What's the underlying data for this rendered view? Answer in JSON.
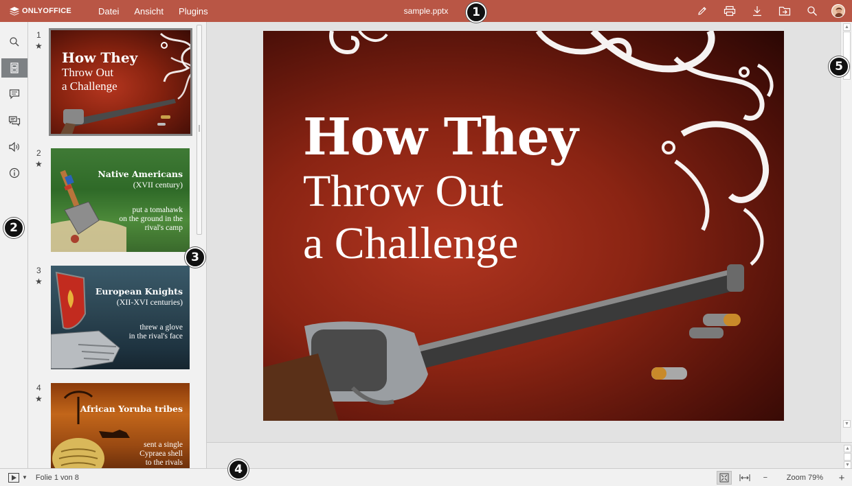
{
  "app": {
    "logo_text": "ONLYOFFICE",
    "document_title": "sample.pptx",
    "menu": [
      "Datei",
      "Ansicht",
      "Plugins"
    ],
    "header_icons": [
      "edit-icon",
      "print-icon",
      "download-icon",
      "open-folder-icon",
      "search-icon",
      "user-avatar"
    ]
  },
  "leftbar": {
    "items": [
      {
        "name": "search-icon",
        "active": false
      },
      {
        "name": "slides-thumbnails-icon",
        "active": true
      },
      {
        "name": "comments-icon",
        "active": false
      },
      {
        "name": "chat-icon",
        "active": false
      },
      {
        "name": "speaker-icon",
        "active": false
      },
      {
        "name": "info-icon",
        "active": false
      }
    ]
  },
  "thumbnails": [
    {
      "number": "1",
      "title": "How They",
      "subtitle": "Throw Out\na Challenge",
      "text": ""
    },
    {
      "number": "2",
      "title": "Native Americans",
      "subtitle": "(XVII century)",
      "text": "put a tomahawk\non the ground in the\nrival's camp"
    },
    {
      "number": "3",
      "title": "European Knights",
      "subtitle": "(XII-XVI centuries)",
      "text": "threw a glove\nin the rival's face"
    },
    {
      "number": "4",
      "title": "African Yoruba tribes",
      "subtitle": "",
      "text": "sent a single\nCypraea shell\nto the rivals"
    }
  ],
  "slide": {
    "title_line1": "How They",
    "title_line2": "Throw Out\na Challenge"
  },
  "statusbar": {
    "slide_info": "Folie 1 von 8",
    "zoom_label": "Zoom 79%",
    "zoom_minus": "−",
    "zoom_plus": "+"
  },
  "callouts": [
    "1",
    "2",
    "3",
    "4",
    "5"
  ],
  "colors": {
    "header": "#b95645",
    "panel": "#f1f1f1",
    "workspace": "#e2e2e2"
  }
}
